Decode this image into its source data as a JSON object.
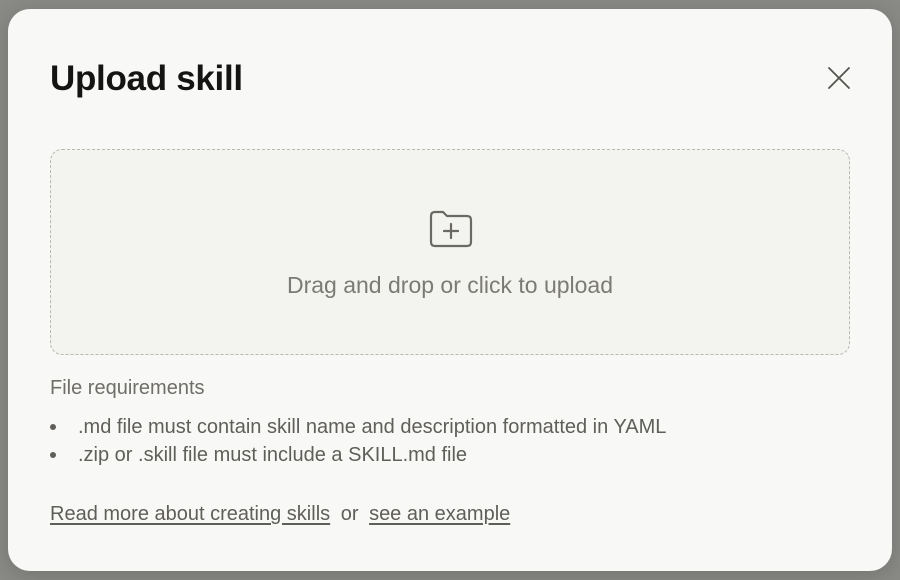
{
  "modal": {
    "title": "Upload skill",
    "close_icon": "close-icon"
  },
  "dropzone": {
    "icon": "folder-plus-icon",
    "label": "Drag and drop or click to upload"
  },
  "requirements": {
    "heading": "File requirements",
    "items": [
      ".md file must contain skill name and description formatted in YAML",
      ".zip or .skill file must include a SKILL.md file"
    ]
  },
  "links": {
    "read_more": "Read more about creating skills",
    "separator": "or",
    "example": "see an example"
  },
  "colors": {
    "modal_background": "#f8f8f6",
    "title_text": "#141413",
    "muted_text": "#7b7a74",
    "dropzone_border": "#b8b7b0",
    "overlay": "#8a8a87"
  }
}
